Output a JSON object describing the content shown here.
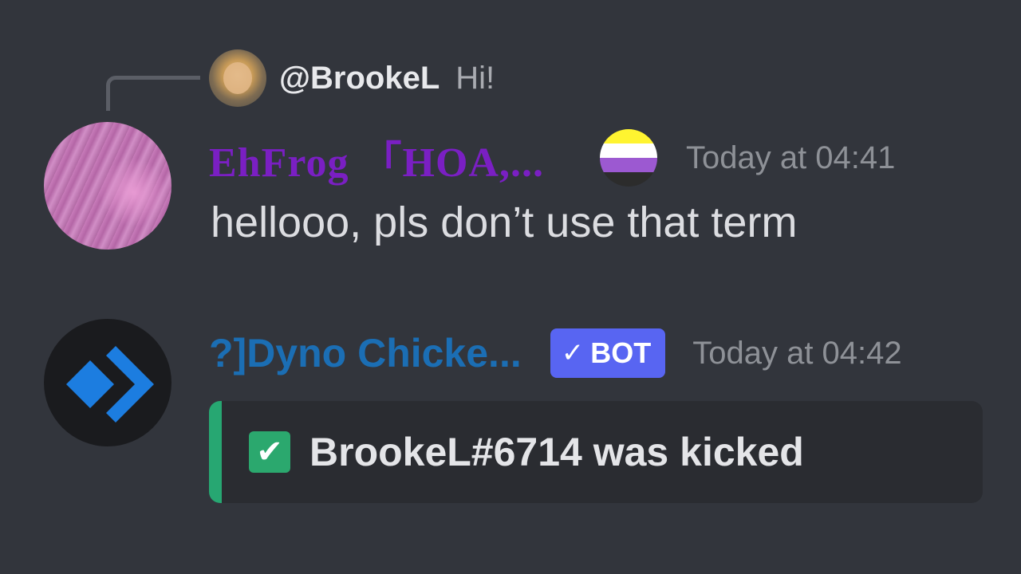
{
  "reply": {
    "username": "@BrookeL",
    "text": "Hi!",
    "avatar_icon": "user-avatar"
  },
  "message1": {
    "username": "EhFrog 「HOA,...",
    "username_color": "#7a1fc3",
    "pronoun_flag": {
      "icon": "nonbinary-flag-icon",
      "colors": [
        "#fff430",
        "#ffffff",
        "#9c59d1",
        "#2c2c2c"
      ]
    },
    "timestamp": "Today at 04:41",
    "text": "hellooo, pls don’t use that term"
  },
  "message2": {
    "username": "?]Dyno Chicke...",
    "username_color": "#1b6eb4",
    "bot_badge": {
      "check": "✓",
      "label": "BOT",
      "color": "#5865f2"
    },
    "timestamp": "Today at 04:42",
    "embed": {
      "accent_color": "#27a772",
      "check_icon": "check-box-icon",
      "check": "✔",
      "title": "BrookeL#6714 was kicked"
    }
  }
}
